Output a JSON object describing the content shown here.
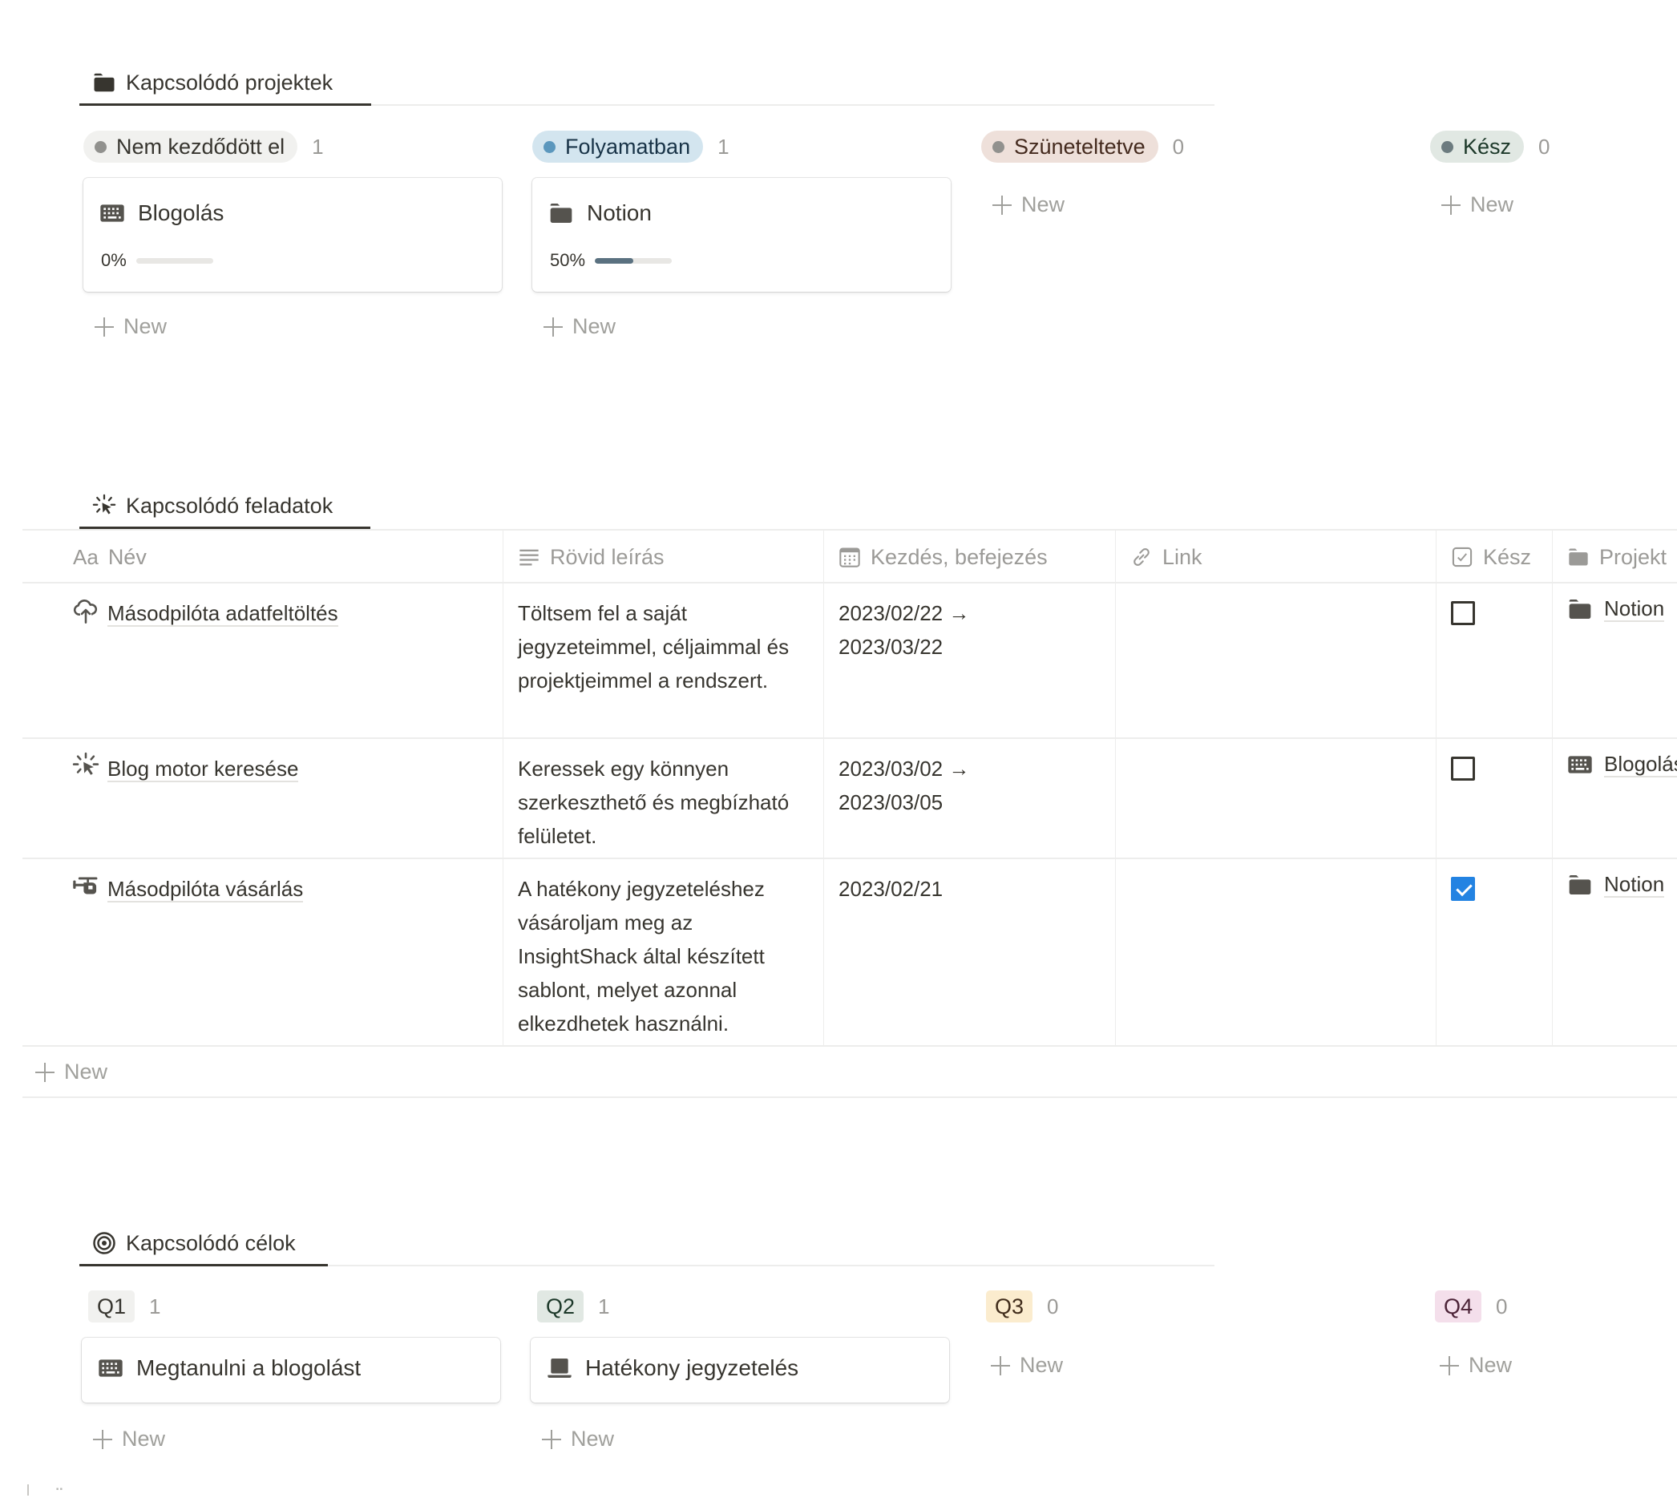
{
  "projects": {
    "tab_label": "Kapcsolódó projektek",
    "tab_icon": "folder-icon",
    "columns": [
      {
        "label": "Nem kezdődött el",
        "count": "1",
        "pill_bg": "#f1f1ef",
        "dot": "#91918e",
        "text_color": "#37352f",
        "cards": [
          {
            "title": "Blogolás",
            "icon": "keyboard-icon",
            "progress_label": "0%",
            "progress": 0
          }
        ]
      },
      {
        "label": "Folyamatban",
        "count": "1",
        "pill_bg": "#d3e5ef",
        "dot": "#5b97bd",
        "text_color": "#183347",
        "cards": [
          {
            "title": "Notion",
            "icon": "folder-icon",
            "progress_label": "50%",
            "progress": 0.5
          }
        ]
      },
      {
        "label": "Szüneteltetve",
        "count": "0",
        "pill_bg": "#eee0da",
        "dot": "#91918e",
        "text_color": "#442a1e",
        "cards": []
      },
      {
        "label": "Kész",
        "count": "0",
        "pill_bg": "#e1e8e3",
        "dot": "#6c7b7f",
        "text_color": "#1c3829",
        "cards": []
      }
    ],
    "new_label": "New"
  },
  "tasks": {
    "tab_label": "Kapcsolódó feladatok",
    "tab_icon": "sparkle-cursor-icon",
    "headers": [
      {
        "label": "Név",
        "icon": "Aa"
      },
      {
        "label": "Rövid leírás",
        "icon": "text-lines-icon"
      },
      {
        "label": "Kezdés, befejezés",
        "icon": "calendar-icon"
      },
      {
        "label": "Link",
        "icon": "link-icon"
      },
      {
        "label": "Kész",
        "icon": "checkbox-icon"
      },
      {
        "label": "Projekt",
        "icon": "folder-icon"
      }
    ],
    "rows": [
      {
        "name": "Másodpilóta adatfeltöltés",
        "icon": "cloud-upload-icon",
        "description": "Töltsem fel a saját jegyzeteimmel, céljaimmal és projektjeimmel a rendszert.",
        "date_start": "2023/02/22 →",
        "date_end": "2023/03/22",
        "link": "",
        "done": false,
        "project": "Notion",
        "project_icon": "folder-icon"
      },
      {
        "name": "Blog motor keresése",
        "icon": "sparkle-cursor-icon",
        "description": "Keressek egy könnyen szerkeszthető és megbízható felületet.",
        "date_start": "2023/03/02 →",
        "date_end": "2023/03/05",
        "link": "",
        "done": false,
        "project": "Blogolás",
        "project_icon": "keyboard-icon"
      },
      {
        "name": "Másodpilóta vásárlás",
        "icon": "helicopter-icon",
        "description": "A hatékony jegyzeteléshez vásároljam meg az InsightShack által készített sablont, melyet azonnal elkezdhetek használni.",
        "date_start": "2023/02/21",
        "date_end": "",
        "link": "",
        "done": true,
        "project": "Notion",
        "project_icon": "folder-icon"
      }
    ],
    "new_label": "New"
  },
  "goals": {
    "tab_label": "Kapcsolódó célok",
    "tab_icon": "target-icon",
    "columns": [
      {
        "label": "Q1",
        "count": "1",
        "tag_bg": "#f1f1ef",
        "text_color": "#37352f",
        "cards": [
          {
            "title": "Megtanulni a blogolást",
            "icon": "keyboard-icon"
          }
        ]
      },
      {
        "label": "Q2",
        "count": "1",
        "tag_bg": "#e1e8e3",
        "text_color": "#1c3829",
        "cards": [
          {
            "title": "Hatékony jegyzetelés",
            "icon": "laptop-icon"
          }
        ]
      },
      {
        "label": "Q3",
        "count": "0",
        "tag_bg": "#fbecce",
        "text_color": "#402c1b",
        "cards": []
      },
      {
        "label": "Q4",
        "count": "0",
        "tag_bg": "#f4dfeb",
        "text_color": "#4c2337",
        "cards": []
      }
    ],
    "new_label": "New"
  }
}
